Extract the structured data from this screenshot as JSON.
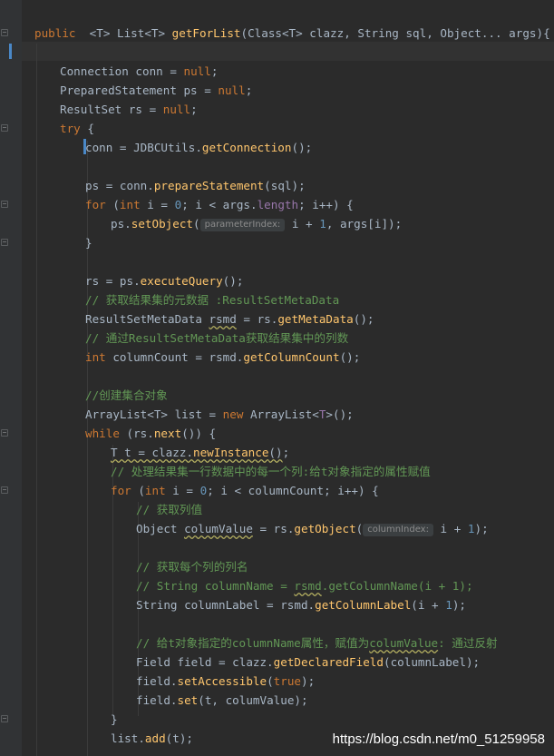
{
  "editor": {
    "theme_colors": {
      "background": "#2b2b2b",
      "gutter": "#313335",
      "keyword": "#cc7832",
      "method": "#ffc66d",
      "comment": "#629755",
      "number": "#6897bb",
      "field": "#9876aa",
      "text": "#a9b7c6"
    },
    "code": {
      "l01": {
        "kw_public": "public",
        "sig_pre": "  <T> List<T> ",
        "fn_name": "getForList",
        "sig_post": "(Class<T> clazz, String sql, Object... args){"
      },
      "l03": {
        "t1": "Connection conn = ",
        "kw": "null",
        "t2": ";"
      },
      "l04": {
        "t1": "PreparedStatement ps = ",
        "kw": "null",
        "t2": ";"
      },
      "l05": {
        "t1": "ResultSet rs = ",
        "kw": "null",
        "t2": ";"
      },
      "l06": {
        "kw": "try",
        "t2": " {"
      },
      "l07": {
        "t1": "conn = JDBCUtils.",
        "m": "getConnection",
        "t2": "();"
      },
      "l09": {
        "t1": "ps = conn.",
        "m": "prepareStatement",
        "t2": "(sql);"
      },
      "l10": {
        "kw_for": "for",
        "t1": " (",
        "kw_int": "int",
        "t2": " i = ",
        "n0": "0",
        "t3": "; i < args.",
        "fld": "length",
        "t4": "; i++) {"
      },
      "l11": {
        "t1": "ps.",
        "m": "setObject",
        "t2": "(",
        "hint": "parameterIndex:",
        "t3": " i + ",
        "n1": "1",
        "t4": ", args[i]);"
      },
      "l12": {
        "t1": "}"
      },
      "l14": {
        "t1": "rs = ps.",
        "m": "executeQuery",
        "t2": "();"
      },
      "l15": {
        "c": "// 获取结果集的元数据 :ResultSetMetaData"
      },
      "l16": {
        "t1": "ResultSetMetaData ",
        "w": "rsmd",
        "t2": " = rs.",
        "m": "getMetaData",
        "t3": "();"
      },
      "l17": {
        "c": "// 通过ResultSetMetaData获取结果集中的列数"
      },
      "l18": {
        "kw": "int",
        "t1": " columnCount = rsmd.",
        "m": "getColumnCount",
        "t2": "();"
      },
      "l20": {
        "c": "//创建集合对象"
      },
      "l21": {
        "t1": "ArrayList<T> list = ",
        "kw": "new",
        "t2": " ArrayList<",
        "t3": "T",
        "t4": ">();"
      },
      "l22": {
        "kw": "while",
        "t1": " (rs.",
        "m": "next",
        "t2": "()) {"
      },
      "l23": {
        "w1": "T t = clazz.",
        "m": "newInstance",
        "w2": "()",
        "t2": ";"
      },
      "l24": {
        "c": "// 处理结果集一行数据中的每一个列:给t对象指定的属性赋值"
      },
      "l25": {
        "kw_for": "for",
        "t1": " (",
        "kw_int": "int",
        "t2": " i = ",
        "n0": "0",
        "t3": "; i < columnCount; i++) {"
      },
      "l26": {
        "c": "// 获取列值"
      },
      "l27": {
        "t1": "Object ",
        "w": "columValue",
        "t2": " = rs.",
        "m": "getObject",
        "t3": "(",
        "hint": "columnIndex:",
        "t4": " i + ",
        "n1": "1",
        "t5": ");"
      },
      "l29": {
        "c": "// 获取每个列的列名"
      },
      "l30": {
        "c1": "// String columnName = ",
        "cw": "rsmd",
        "c2": ".getColumnName(i + 1);"
      },
      "l31": {
        "t1": "String columnLabel = rsmd.",
        "m": "getColumnLabel",
        "t2": "(i + ",
        "n1": "1",
        "t3": ");"
      },
      "l33": {
        "c1": "// 给t对象指定的columnName属性，赋值为",
        "cw": "columValue",
        "c2": ": 通过反射"
      },
      "l34": {
        "t1": "Field field = clazz.",
        "m": "getDeclaredField",
        "t2": "(columnLabel);"
      },
      "l35": {
        "t1": "field.",
        "m": "setAccessible",
        "t2": "(",
        "kw": "true",
        "t3": ");"
      },
      "l36": {
        "t1": "field.",
        "m": "set",
        "t2": "(t, columValue);"
      },
      "l37": {
        "t1": "}"
      },
      "l38": {
        "t1": "list.",
        "m": "add",
        "t2": "(t);"
      }
    }
  },
  "watermark": "https://blog.csdn.net/m0_51259958"
}
